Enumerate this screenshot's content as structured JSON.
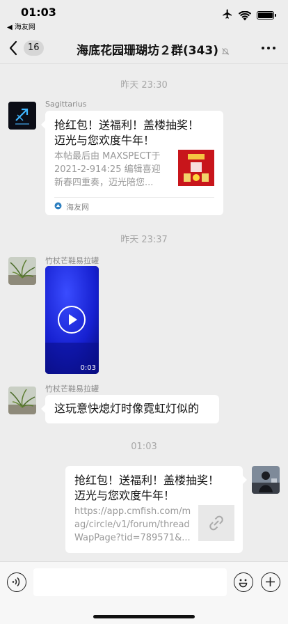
{
  "status_bar": {
    "time": "01:03",
    "back_app": "◀ 海友网",
    "icons": [
      "airplane-icon",
      "wifi-icon",
      "battery-icon"
    ]
  },
  "nav": {
    "back_count": "16",
    "title": "海底花园珊瑚坊２群(343)",
    "icons": [
      "back-chevron-icon",
      "mute-bell-icon",
      "more-dots-icon"
    ]
  },
  "messages": {
    "ts1": "昨天 23:30",
    "m1": {
      "sender": "Sagittarius",
      "card_title": "抢红包！送福利！盖楼抽奖！迈光与您欢度牛年！",
      "card_title_l1": "抢红包！送福利！盖楼抽奖！",
      "card_title_l2": "迈光与您欢度牛年！",
      "card_desc_l1": "本帖最后由 MAXSPECT于",
      "card_desc_l2": "2021-2-914:25 编辑喜迎",
      "card_desc_l3": "新春四重奏，迈光陪您...",
      "source": "海友网"
    },
    "ts2": "昨天 23:37",
    "m2": {
      "sender": "竹杖芒鞋易拉罐",
      "video_duration": "0:03"
    },
    "m3": {
      "sender": "竹杖芒鞋易拉罐",
      "text": "这玩意快熄灯时像霓虹灯似的"
    },
    "ts3": "01:03",
    "m4": {
      "card_title_l1": "抢红包！送福利！盖楼抽奖！",
      "card_title_l2": "迈光与您欢度牛年！",
      "link_l1": "https://app.cmfish.com/m",
      "link_l2": "ag/circle/v1/forum/thread",
      "link_l3": "WapPage?tid=789571&..."
    }
  },
  "input_bar": {
    "icons": [
      "voice-icon",
      "emoji-icon",
      "plus-icon"
    ]
  },
  "colors": {
    "background": "#ededed",
    "bubble": "#ffffff",
    "timestamp": "#a7a7a7",
    "video_blue": "#1a22d8"
  }
}
